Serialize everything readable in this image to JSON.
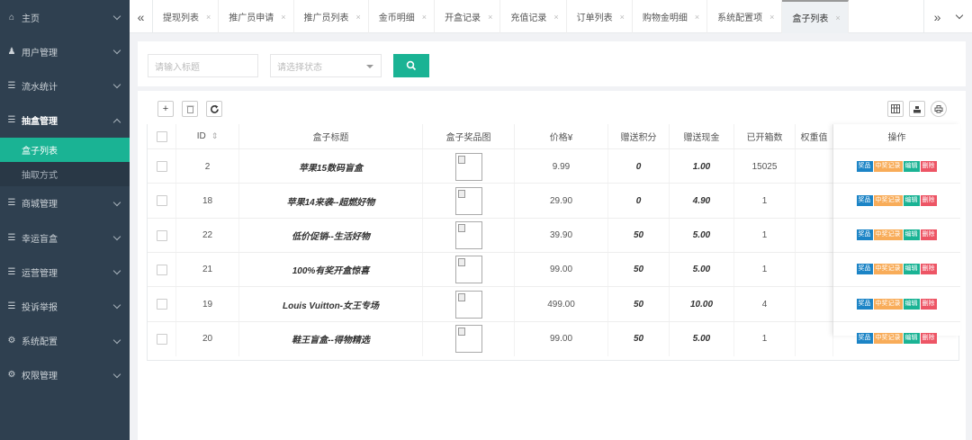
{
  "sidebar": {
    "items": [
      {
        "icon": "home-icon",
        "glyph": "⌂",
        "label": "主页",
        "open": false
      },
      {
        "icon": "users-icon",
        "glyph": "♟",
        "label": "用户管理",
        "open": false
      },
      {
        "icon": "list-icon",
        "glyph": "☰",
        "label": "流水统计",
        "open": false
      },
      {
        "icon": "list-icon",
        "glyph": "☰",
        "label": "抽盒管理",
        "open": true,
        "children": [
          {
            "label": "盒子列表",
            "active": true
          },
          {
            "label": "抽取方式",
            "active": false
          }
        ]
      },
      {
        "icon": "list-icon",
        "glyph": "☰",
        "label": "商城管理",
        "open": false
      },
      {
        "icon": "list-icon",
        "glyph": "☰",
        "label": "幸运盲盒",
        "open": false
      },
      {
        "icon": "list-icon",
        "glyph": "☰",
        "label": "运营管理",
        "open": false
      },
      {
        "icon": "list-icon",
        "glyph": "☰",
        "label": "投诉举报",
        "open": false
      },
      {
        "icon": "settings-icon",
        "glyph": "⚙",
        "label": "系统配置",
        "open": false
      },
      {
        "icon": "gear-icon",
        "glyph": "⚙",
        "label": "权限管理",
        "open": false
      }
    ]
  },
  "tabs": {
    "left_icon": "double-chevron-left-icon",
    "right_icon": "double-chevron-right-icon",
    "items": [
      {
        "label": "提现列表",
        "active": false
      },
      {
        "label": "推广员申请",
        "active": false
      },
      {
        "label": "推广员列表",
        "active": false
      },
      {
        "label": "金币明细",
        "active": false
      },
      {
        "label": "开盒记录",
        "active": false
      },
      {
        "label": "充值记录",
        "active": false
      },
      {
        "label": "订单列表",
        "active": false
      },
      {
        "label": "购物金明细",
        "active": false
      },
      {
        "label": "系统配置项",
        "active": false
      },
      {
        "label": "盒子列表",
        "active": true
      }
    ],
    "close_glyph": "×"
  },
  "search": {
    "title_placeholder": "请输入标题",
    "status_placeholder": "请选择状态",
    "button_icon": "search-icon"
  },
  "toolbar": {
    "add": "+",
    "delete_icon": "trash-icon",
    "refresh_icon": "refresh-icon",
    "columns_icon": "columns-icon",
    "export_icon": "export-icon",
    "print_icon": "print-icon"
  },
  "table": {
    "headers": {
      "id": "ID",
      "sort_glyph": "⇕",
      "title": "盒子标题",
      "image": "盒子奖品图",
      "price": "价格¥",
      "points": "赠送积分",
      "cash": "赠送现金",
      "opened": "已开箱数",
      "weight": "权重值",
      "ops": "操作"
    },
    "rows": [
      {
        "id": "2",
        "title": "苹果15数码盲盒",
        "price": "9.99",
        "points": "0",
        "cash": "1.00",
        "opened": "15025"
      },
      {
        "id": "18",
        "title": "苹果14来袭--超燃好物",
        "price": "29.90",
        "points": "0",
        "cash": "4.90",
        "opened": "1"
      },
      {
        "id": "22",
        "title": "低价促销--生活好物",
        "price": "39.90",
        "points": "50",
        "cash": "5.00",
        "opened": "1"
      },
      {
        "id": "21",
        "title": "100%有奖开盒惊喜",
        "price": "99.00",
        "points": "50",
        "cash": "5.00",
        "opened": "1"
      },
      {
        "id": "19",
        "title": "Louis Vuitton-女王专场",
        "price": "499.00",
        "points": "50",
        "cash": "10.00",
        "opened": "4"
      },
      {
        "id": "20",
        "title": "鞋王盲盒--得物精选",
        "price": "99.00",
        "points": "50",
        "cash": "5.00",
        "opened": "1"
      }
    ],
    "actions": {
      "prize": "奖品",
      "records": "中奖记录",
      "edit": "编辑",
      "delete": "删除"
    }
  },
  "colors": {
    "sidebar_bg": "#2f4050",
    "accent": "#1ab394",
    "blue": "#1c84c6",
    "yellow": "#f8ac59",
    "red": "#ed5565"
  }
}
